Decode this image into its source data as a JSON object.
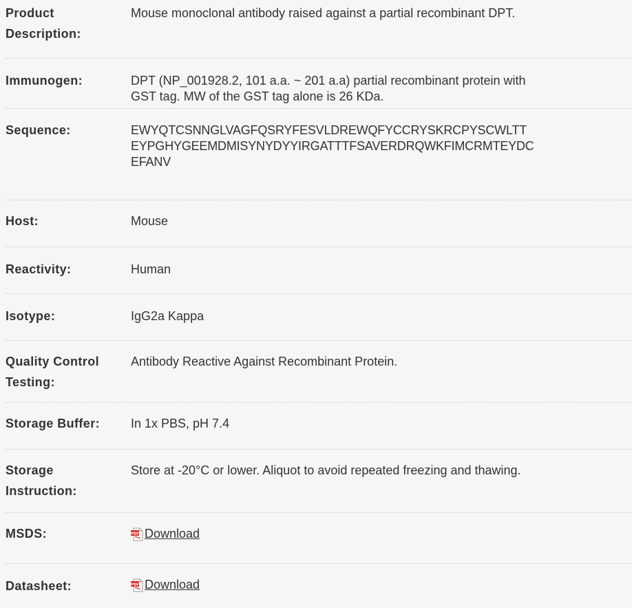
{
  "rows": [
    {
      "label_lines": [
        "Product",
        "Description:"
      ],
      "value_lines": [
        "Mouse monoclonal antibody raised against a partial recombinant DPT."
      ]
    },
    {
      "label_lines": [
        "Immunogen:"
      ],
      "value_lines": [
        "DPT (NP_001928.2, 101 a.a. ~ 201 a.a) partial recombinant protein with",
        "GST tag. MW of the GST tag alone is 26 KDa."
      ]
    },
    {
      "label_lines": [
        "Sequence:"
      ],
      "value_lines": [
        "EWYQTCSNNGLVAGFQSRYFESVLDREWQFYCCRYSKRCPYSCWLTT",
        "EYPGHYGEEMDMISYNYDYYIRGATTTFSAVERDRQWKFIMCRMTEYDC",
        "EFANV"
      ]
    },
    {
      "label_lines": [
        "Host:"
      ],
      "value_lines": [
        "Mouse"
      ]
    },
    {
      "label_lines": [
        "Reactivity:"
      ],
      "value_lines": [
        "Human"
      ]
    },
    {
      "label_lines": [
        "Isotype:"
      ],
      "value_lines": [
        "IgG2a Kappa"
      ]
    },
    {
      "label_lines": [
        "Quality Control",
        "Testing:"
      ],
      "value_lines": [
        "Antibody Reactive Against Recombinant Protein."
      ]
    },
    {
      "label_lines": [
        "Storage Buffer:"
      ],
      "value_lines": [
        "In 1x PBS, pH 7.4"
      ]
    },
    {
      "label_lines": [
        "Storage",
        "Instruction:"
      ],
      "value_lines": [
        "Store at -20°C or lower. Aliquot to avoid repeated freezing and thawing."
      ]
    }
  ],
  "msds": {
    "label": "MSDS:",
    "link_text": "Download",
    "icon": "pdf-icon"
  },
  "datasheet": {
    "label": "Datasheet:",
    "link_text": "Download",
    "icon": "pdf-icon"
  },
  "colors": {
    "background": "#f6f6f6",
    "text": "#333333",
    "separator": "#c9c9c9",
    "pdf_red": "#d9261c"
  }
}
